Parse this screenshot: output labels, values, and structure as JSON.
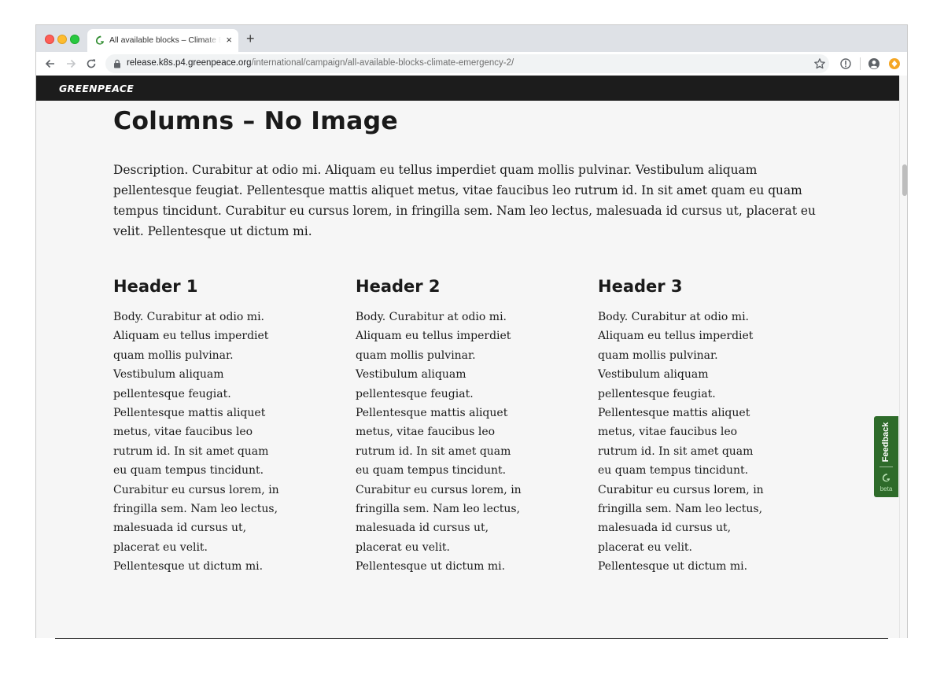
{
  "browser": {
    "tab_title": "All available blocks – Climate Emergency",
    "tab_close": "×",
    "new_tab": "+",
    "url_host": "release.k8s.p4.greenpeace.org",
    "url_path": "/international/campaign/all-available-blocks-climate-emergency-2/"
  },
  "site": {
    "logo_text": "GREENPEACE"
  },
  "main": {
    "title": "Columns – No Image",
    "description": "Description. Curabitur at odio mi. Aliquam eu tellus imperdiet quam mollis pulvinar. Vestibulum aliquam pellentesque feugiat. Pellentesque mattis aliquet metus, vitae faucibus leo rutrum id. In sit amet quam eu quam tempus tincidunt. Curabitur eu cursus lorem, in fringilla sem. Nam leo lectus, malesuada id cursus ut, placerat eu velit. Pellentesque ut dictum mi.",
    "columns": [
      {
        "header": "Header 1",
        "body": "Body. Curabitur at odio mi. Aliquam eu tellus imperdiet quam mollis pulvinar. Vestibulum aliquam pellentesque feugiat. Pellentesque mattis aliquet metus, vitae faucibus leo rutrum id. In sit amet quam eu quam tempus tincidunt. Curabitur eu cursus lorem, in fringilla sem. Nam leo lectus, malesuada id cursus ut, placerat eu velit. Pellentesque ut dictum mi."
      },
      {
        "header": "Header 2",
        "body": "Body. Curabitur at odio mi. Aliquam eu tellus imperdiet quam mollis pulvinar. Vestibulum aliquam pellentesque feugiat. Pellentesque mattis aliquet metus, vitae faucibus leo rutrum id. In sit amet quam eu quam tempus tincidunt. Curabitur eu cursus lorem, in fringilla sem. Nam leo lectus, malesuada id cursus ut, placerat eu velit. Pellentesque ut dictum mi."
      },
      {
        "header": "Header 3",
        "body": "Body. Curabitur at odio mi. Aliquam eu tellus imperdiet quam mollis pulvinar. Vestibulum aliquam pellentesque feugiat. Pellentesque mattis aliquet metus, vitae faucibus leo rutrum id. In sit amet quam eu quam tempus tincidunt. Curabitur eu cursus lorem, in fringilla sem. Nam leo lectus, malesuada id cursus ut, placerat eu velit. Pellentesque ut dictum mi."
      }
    ]
  },
  "feedback": {
    "label": "Feedback",
    "beta": "beta"
  },
  "icons": {
    "back": "arrow-left-icon",
    "forward": "arrow-right-icon",
    "reload": "reload-icon",
    "lock": "lock-icon",
    "bookmark": "star-icon",
    "info": "info-icon",
    "profile": "account-icon",
    "extension": "extension-icon",
    "favicon": "greenpeace-favicon-icon"
  },
  "colors": {
    "site_header": "#1c1c1c",
    "feedback_green": "#2e6b2a",
    "favicon_green": "#2e8b2e"
  }
}
